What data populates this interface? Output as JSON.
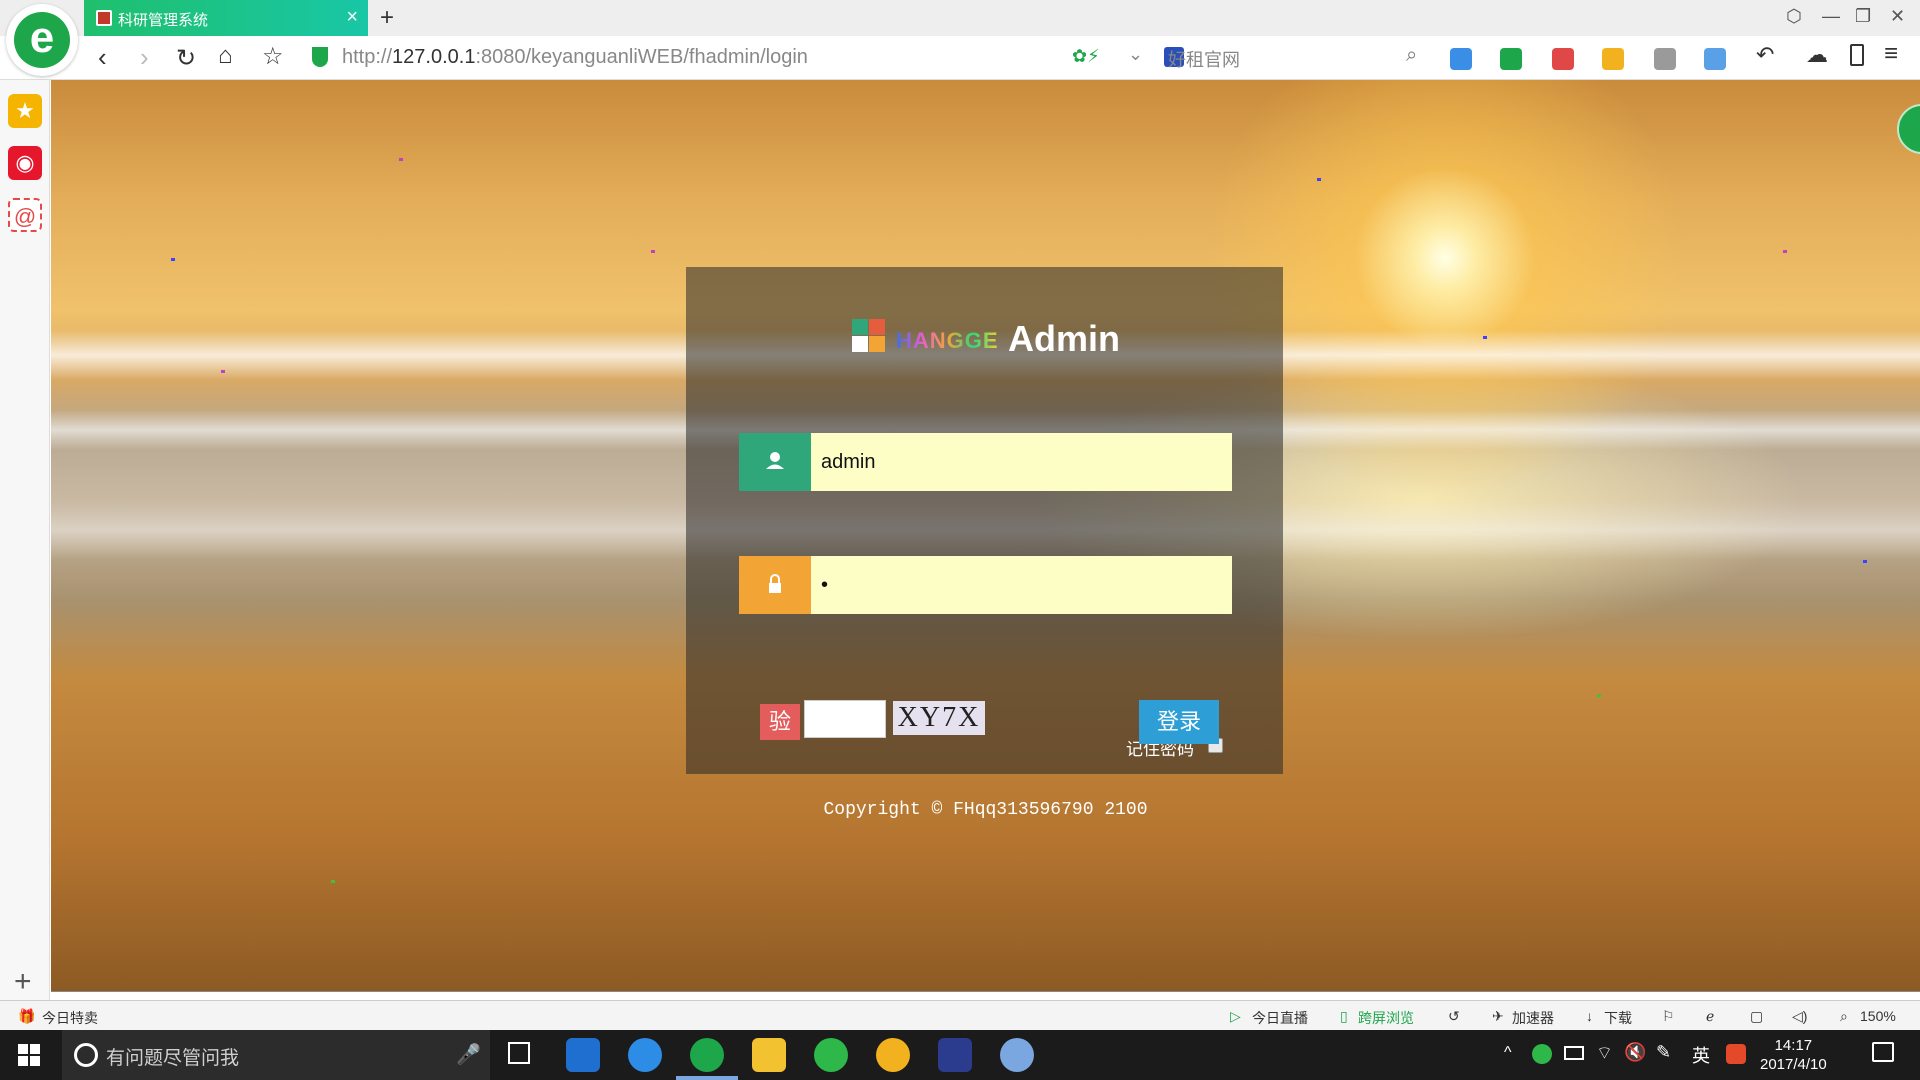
{
  "browser": {
    "tab_title": "科研管理系统",
    "url_prefix": "http://",
    "url_host": "127.0.0.1",
    "url_rest": ":8080/keyanguanliWEB/fhadmin/login",
    "search_hint": "好租官网"
  },
  "sidebar": {
    "items": [
      {
        "icon": "star-icon",
        "color": "#f4b400"
      },
      {
        "icon": "weibo-icon",
        "color": "#e6162d"
      },
      {
        "icon": "mail-icon",
        "color": "#e44a4a"
      }
    ]
  },
  "login": {
    "logo_hangge": "HANGGE",
    "logo_admin": "Admin",
    "username_value": "admin",
    "password_value": "•",
    "remember_label": "记住密码",
    "captcha_tag": "验",
    "captcha_code": "XY7X",
    "login_button": "登录",
    "copyright": "Copyright © FHqq313596790 2100"
  },
  "statusbar": {
    "left_item": "今日特卖",
    "live": "今日直播",
    "cross_screen": "跨屏浏览",
    "accelerator": "加速器",
    "download": "下载",
    "zoom": "150%"
  },
  "taskbar": {
    "search_placeholder": "有问题尽管问我",
    "time": "14:17",
    "date": "2017/4/10",
    "ime": "英"
  },
  "colors": {
    "accent_green": "#1fbf6d",
    "user_icon_bg": "#2fa77a",
    "lock_icon_bg": "#f2a535",
    "input_bg": "#fdfdc6",
    "login_button": "#2e9fd6",
    "captcha_tag": "#e45d5d"
  }
}
